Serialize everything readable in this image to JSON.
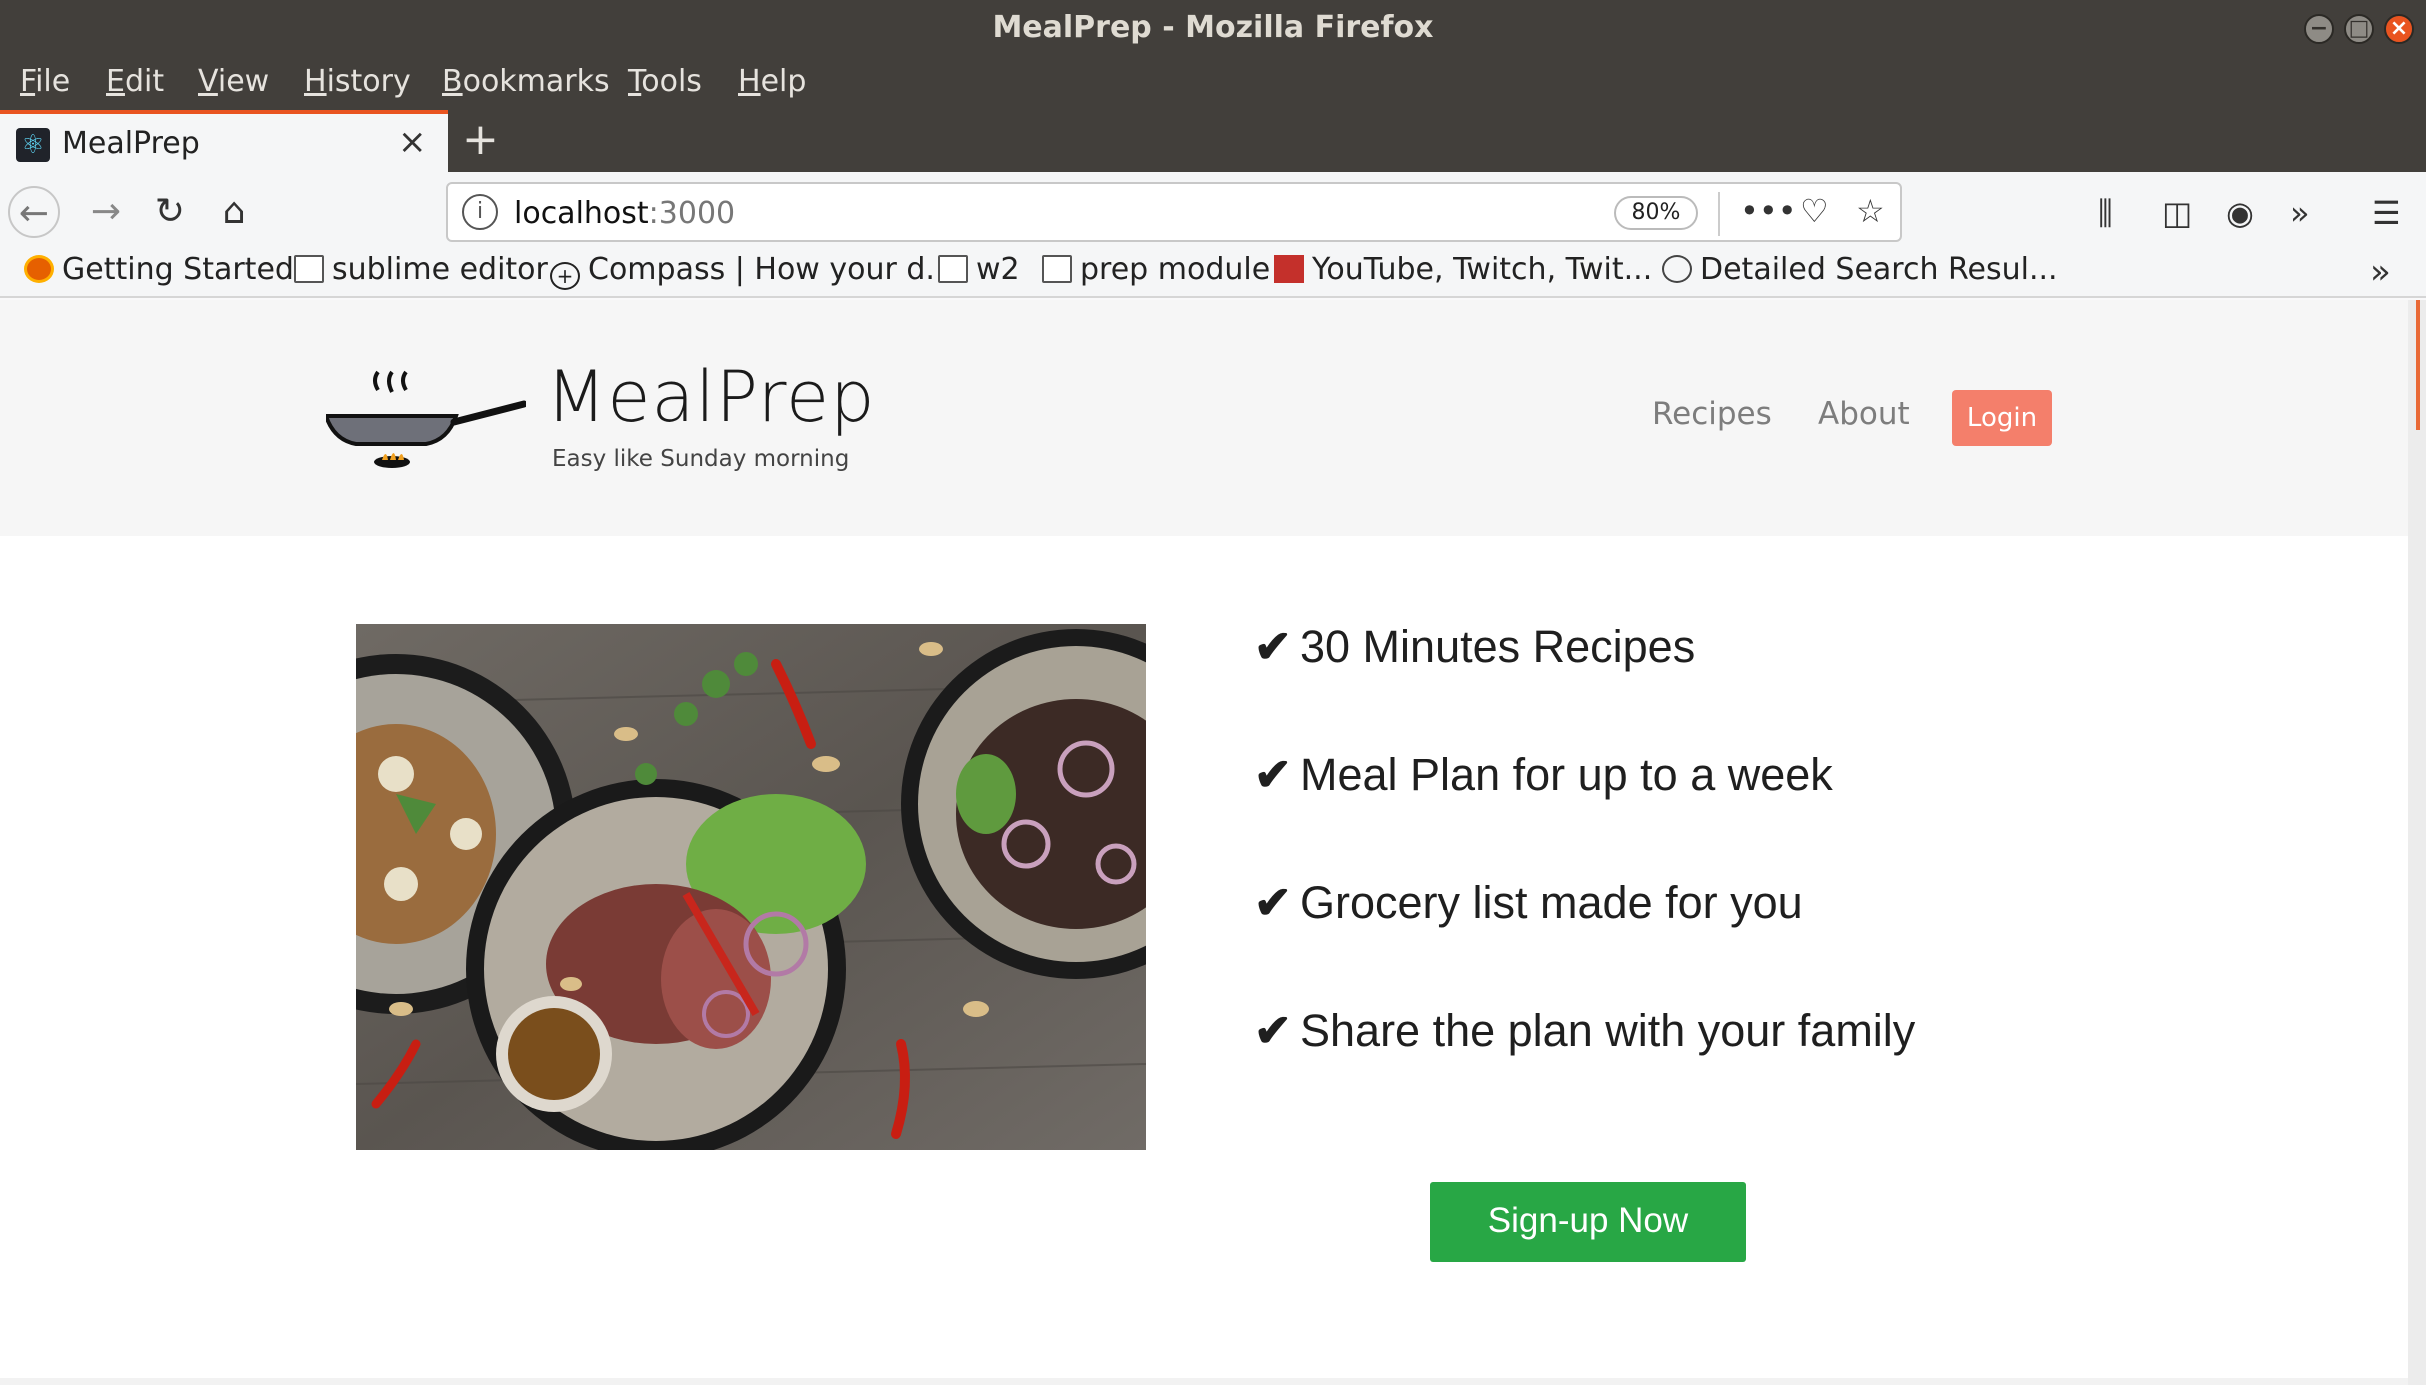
{
  "window": {
    "title": "MealPrep - Mozilla Firefox"
  },
  "menu": [
    "File",
    "Edit",
    "View",
    "History",
    "Bookmarks",
    "Tools",
    "Help"
  ],
  "tab": {
    "label": "MealPrep",
    "close_glyph": "×",
    "new_tab_glyph": "+"
  },
  "nav": {
    "url_host": "localhost",
    "url_port": ":3000",
    "zoom": "80%"
  },
  "bookmarks": [
    {
      "label": "Getting Started",
      "icon": "firefox-icon"
    },
    {
      "label": "sublime editor",
      "icon": "folder-icon"
    },
    {
      "label": "Compass | How your d...",
      "icon": "compass-icon"
    },
    {
      "label": "w2",
      "icon": "folder-icon"
    },
    {
      "label": "prep module",
      "icon": "folder-icon"
    },
    {
      "label": "YouTube, Twitch, Twit...",
      "icon": "chart-icon"
    },
    {
      "label": "Detailed Search Resul...",
      "icon": "globe-icon"
    }
  ],
  "site": {
    "brand": "MealPrep",
    "tagline": "Easy like Sunday morning",
    "nav_links": [
      "Recipes",
      "About"
    ],
    "login_label": "Login",
    "features": [
      "30 Minutes Recipes",
      "Meal Plan for up to a week",
      "Grocery list made for you",
      "Share the plan with your family"
    ],
    "check_glyph": "✔",
    "signup_label": "Sign-up Now"
  },
  "colors": {
    "accent_tab": "#e95420",
    "login_bg": "#f47f6b",
    "signup_bg": "#28a745"
  }
}
